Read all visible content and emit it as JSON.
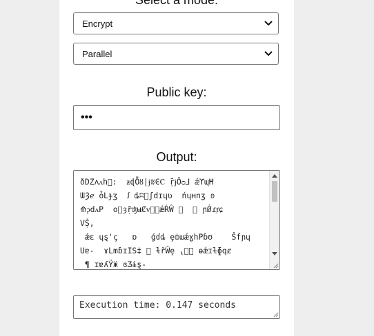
{
  "labels": {
    "mode_heading": "Select a mode:",
    "public_key": "Public key:",
    "output": "Output:"
  },
  "mode_select": {
    "value": "Encrypt"
  },
  "execution_select": {
    "value": "Parallel"
  },
  "public_key_input": {
    "masked_value": "•••"
  },
  "output_area": {
    "text": "ðDZʌᴧh⃝:  ᵶɖȬȣ|ɉʬϾⲤ ṝɉǑᴑ⅃ ǽϒɰĦ\nƜȜℯ ȱⅬɟʒ  ꭍ ȡʭ⃝ʃdɪɥʋ  ńɥʜnʒ ʚ\n⟰ᶗdᴧP  o⃝ȝṝʤʉȻᴠᴕ⃝ǽṘŴ ⏤  ꭍ ɲǾɾⱦɕ\nVṨ,\n ǽɛ ɥȿ'ç   ɒ   ǵɗȡ ȩȸɯǽɣhPɓʊ    Ŝfɲɥ\nUɐ-  ɤLmɓɪIS‡ ⃝ ɫřŴȩ ⸤ɉ⃝ ⱺǽɪɫɸqȼ\n ¶ ɪɐʎŸӝ ɞƷɨȿ-\n  ̈ ̈  ̈ ̈  ̈ ̈   ̈ "
  },
  "execution_time": {
    "text": "Execution time: 0.147 seconds"
  }
}
